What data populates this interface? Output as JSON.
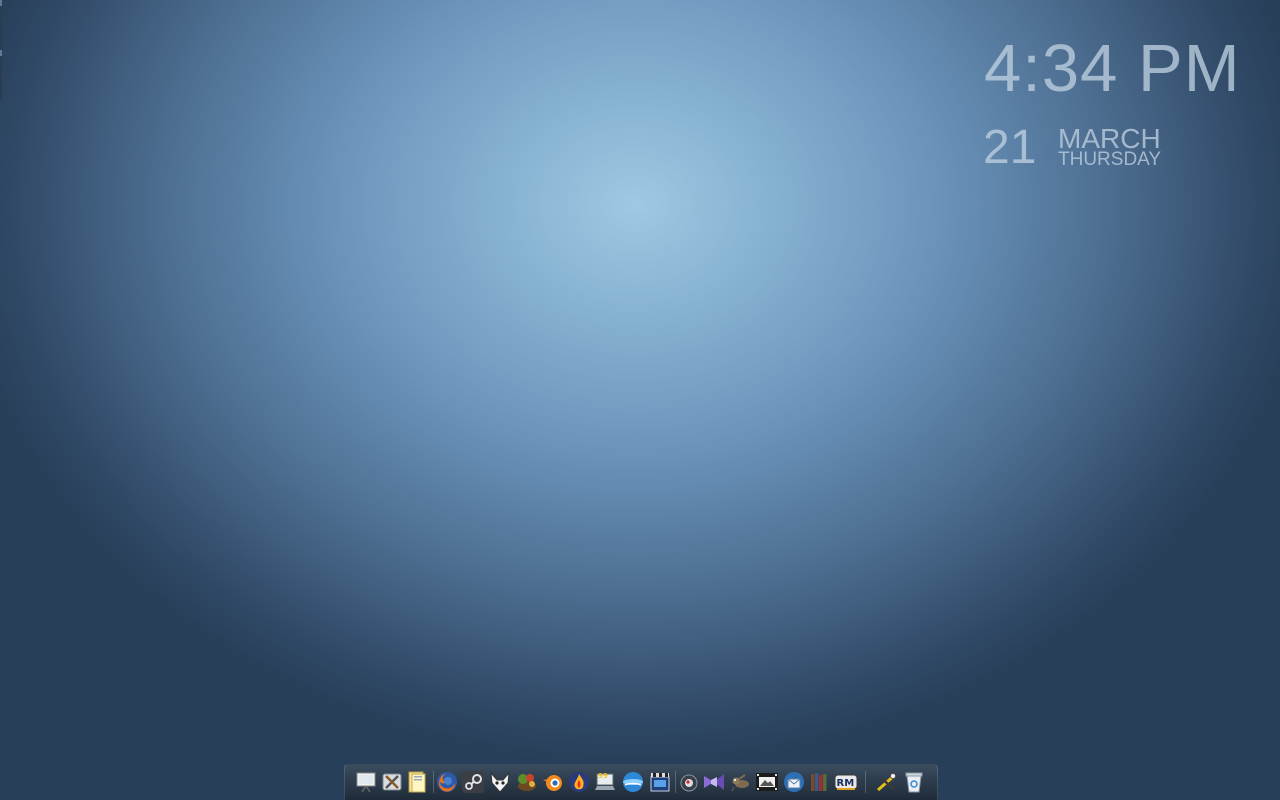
{
  "desktop": {
    "background_center_color": "#9dc9e2",
    "background_edge_color": "#283f59"
  },
  "clock": {
    "time": "4:34 PM",
    "day": "21",
    "month": "MARCH",
    "weekday": "THURSDAY",
    "text_color": "#bed0e0"
  },
  "dock": {
    "items": [
      {
        "icon": "presentation-icon",
        "app": "Slideshow"
      },
      {
        "icon": "tools-icon",
        "app": "Utilities"
      },
      {
        "icon": "folder-icon",
        "app": "Files"
      },
      {
        "icon": "firefox-icon",
        "app": "Firefox"
      },
      {
        "icon": "steam-icon",
        "app": "Steam"
      },
      {
        "icon": "foobar-icon",
        "app": "Media player"
      },
      {
        "icon": "game-icon",
        "app": "Game"
      },
      {
        "icon": "blender-icon",
        "app": "Blender"
      },
      {
        "icon": "fire-icon",
        "app": "Media"
      },
      {
        "icon": "laptop-icon",
        "app": "System"
      },
      {
        "icon": "maxthon-icon",
        "app": "Browser"
      },
      {
        "icon": "film-clapper-icon",
        "app": "Video"
      },
      {
        "icon": "camera-icon",
        "app": "Camera"
      },
      {
        "icon": "visual-studio-icon",
        "app": "Visual Studio"
      },
      {
        "icon": "gimp-icon",
        "app": "GIMP"
      },
      {
        "icon": "film-strip-icon",
        "app": "Movie maker"
      },
      {
        "icon": "thunderbird-icon",
        "app": "Mail"
      },
      {
        "icon": "books-icon",
        "app": "Library"
      },
      {
        "icon": "rm-icon",
        "app": "RM"
      },
      {
        "icon": "scissors-icon",
        "app": "Snipping"
      },
      {
        "icon": "recycle-bin-icon",
        "app": "Recycle Bin"
      }
    ]
  }
}
